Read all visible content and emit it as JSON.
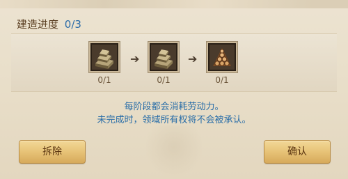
{
  "progress": {
    "label": "建造进度",
    "value": "0/3"
  },
  "stages": [
    {
      "icon": "stacked-stone-icon",
      "count": "0/1"
    },
    {
      "icon": "stacked-stone-icon",
      "count": "0/1"
    },
    {
      "icon": "log-pile-icon",
      "count": "0/1"
    }
  ],
  "info": {
    "line1": "每阶段都会消耗劳动力。",
    "line2": "未完成时，领域所有权将不会被承认。"
  },
  "buttons": {
    "demolish": "拆除",
    "confirm": "确认"
  },
  "colors": {
    "accent_blue": "#2c6ca8",
    "brown_text": "#5b3f22",
    "button_gold": "#e8c57a"
  }
}
